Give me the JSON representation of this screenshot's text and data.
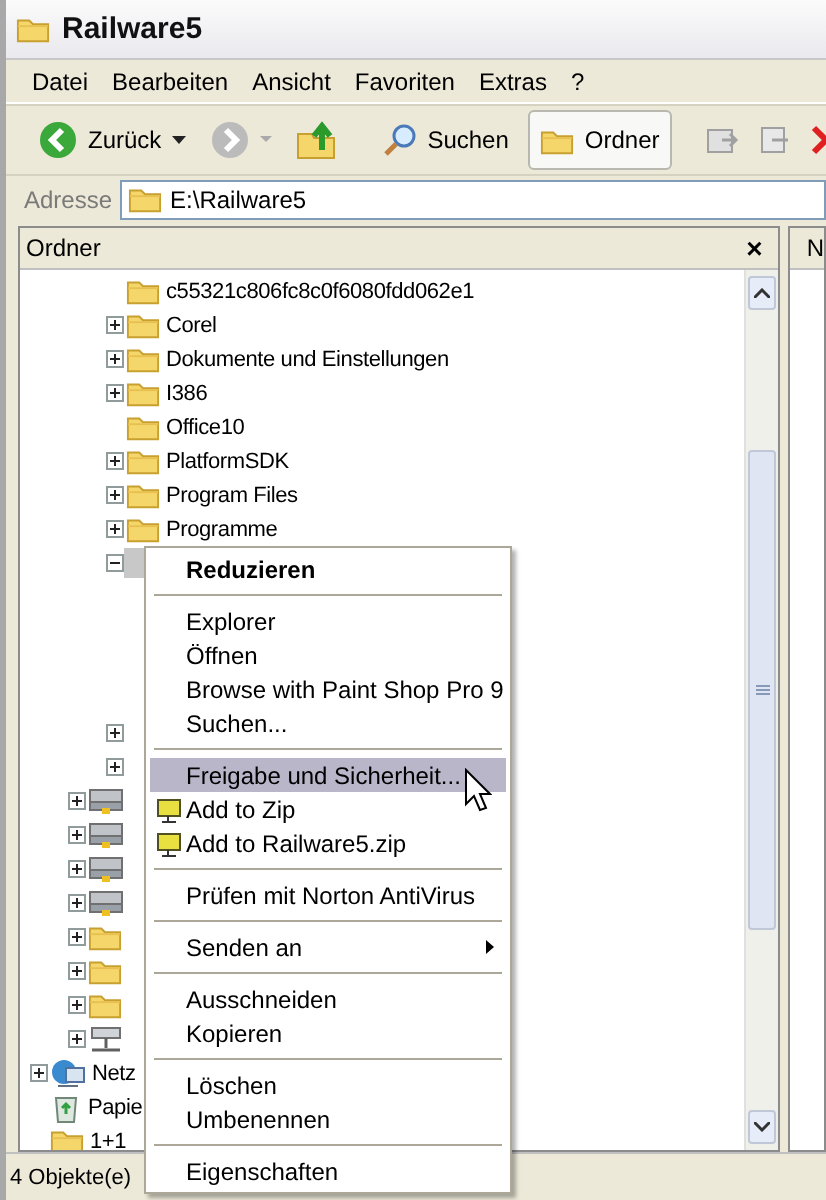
{
  "window": {
    "title": "Railware5"
  },
  "menu_bar": [
    "Datei",
    "Bearbeiten",
    "Ansicht",
    "Favoriten",
    "Extras",
    "?"
  ],
  "toolbar": [
    {
      "label": "Zurück",
      "selected": false
    },
    {
      "label": "Suchen",
      "selected": false
    },
    {
      "label": "Ordner",
      "selected": true
    }
  ],
  "address": {
    "label": "Adresse",
    "value": "E:\\Railware5"
  },
  "folders_panel": {
    "title": "Ordner",
    "close": "×"
  },
  "tree": [
    {
      "children": [
        {
          "children": [
            {
              "label": "c55321c806fc8c0f6080fdd062e1",
              "kind": "folder",
              "selected": false
            },
            {
              "label": "Corel",
              "kind": "folder",
              "expanded": false,
              "selected": false
            },
            {
              "label": "Dokumente und Einstellungen",
              "kind": "folder",
              "expanded": false,
              "selected": false
            },
            {
              "label": "I386",
              "kind": "folder",
              "expanded": false,
              "selected": false
            },
            {
              "label": "Office10",
              "kind": "folder",
              "selected": false
            },
            {
              "label": "PlatformSDK",
              "kind": "folder",
              "expanded": false,
              "selected": false
            },
            {
              "label": "Program Files",
              "kind": "folder",
              "expanded": false,
              "selected": false
            },
            {
              "label": "Programme",
              "kind": "folder",
              "expanded": false,
              "selected": false
            },
            {
              "expanded": true,
              "selected": true
            },
            {
              "expanded": false
            },
            {
              "expanded": false
            }
          ]
        },
        {
          "kind": "drive",
          "expanded": false
        },
        {
          "kind": "drive",
          "expanded": false
        },
        {
          "kind": "drive",
          "expanded": false
        },
        {
          "kind": "drive",
          "expanded": false
        },
        {
          "kind": "folder",
          "expanded": false
        },
        {
          "kind": "folder",
          "expanded": false
        },
        {
          "kind": "folder",
          "expanded": false
        },
        {
          "kind": "netdrive",
          "expanded": false
        }
      ]
    },
    {
      "label": "Netz",
      "kind": "network",
      "expanded": false,
      "selected": false
    },
    {
      "label": "Papie",
      "kind": "recycle",
      "selected": false
    },
    {
      "label": "1+1",
      "kind": "folder",
      "selected": false
    }
  ],
  "right_pane": {
    "header": "N"
  },
  "context_menu": [
    {
      "kind": "item",
      "label": "Reduzieren",
      "default": true,
      "selected": false
    },
    {
      "kind": "separator"
    },
    {
      "kind": "item",
      "label": "Explorer",
      "default": false,
      "selected": false
    },
    {
      "kind": "item",
      "label": "Öffnen",
      "default": false,
      "selected": false
    },
    {
      "kind": "item",
      "label": "Browse with Paint Shop Pro 9",
      "default": false,
      "selected": false
    },
    {
      "kind": "item",
      "label": "Suchen...",
      "default": false,
      "selected": false
    },
    {
      "kind": "separator"
    },
    {
      "kind": "item",
      "label": "Freigabe und Sicherheit...",
      "default": false,
      "selected": true
    },
    {
      "kind": "zip",
      "label": "Add to Zip",
      "default": false,
      "selected": false
    },
    {
      "kind": "zip",
      "label": "Add to Railware5.zip",
      "default": false,
      "selected": false
    },
    {
      "kind": "separator"
    },
    {
      "kind": "item",
      "label": "Prüfen mit Norton AntiVirus",
      "default": false,
      "selected": false
    },
    {
      "kind": "separator"
    },
    {
      "kind": "submenu",
      "label": "Senden an",
      "default": false,
      "selected": false
    },
    {
      "kind": "separator"
    },
    {
      "kind": "item",
      "label": "Ausschneiden",
      "default": false,
      "selected": false
    },
    {
      "kind": "item",
      "label": "Kopieren",
      "default": false,
      "selected": false
    },
    {
      "kind": "separator"
    },
    {
      "kind": "item",
      "label": "Löschen",
      "default": false,
      "selected": false
    },
    {
      "kind": "item",
      "label": "Umbenennen",
      "default": false,
      "selected": false
    },
    {
      "kind": "separator"
    },
    {
      "kind": "item",
      "label": "Eigenschaften",
      "default": false,
      "selected": false
    }
  ],
  "status_bar": {
    "text": "4 Objekte(e)"
  }
}
